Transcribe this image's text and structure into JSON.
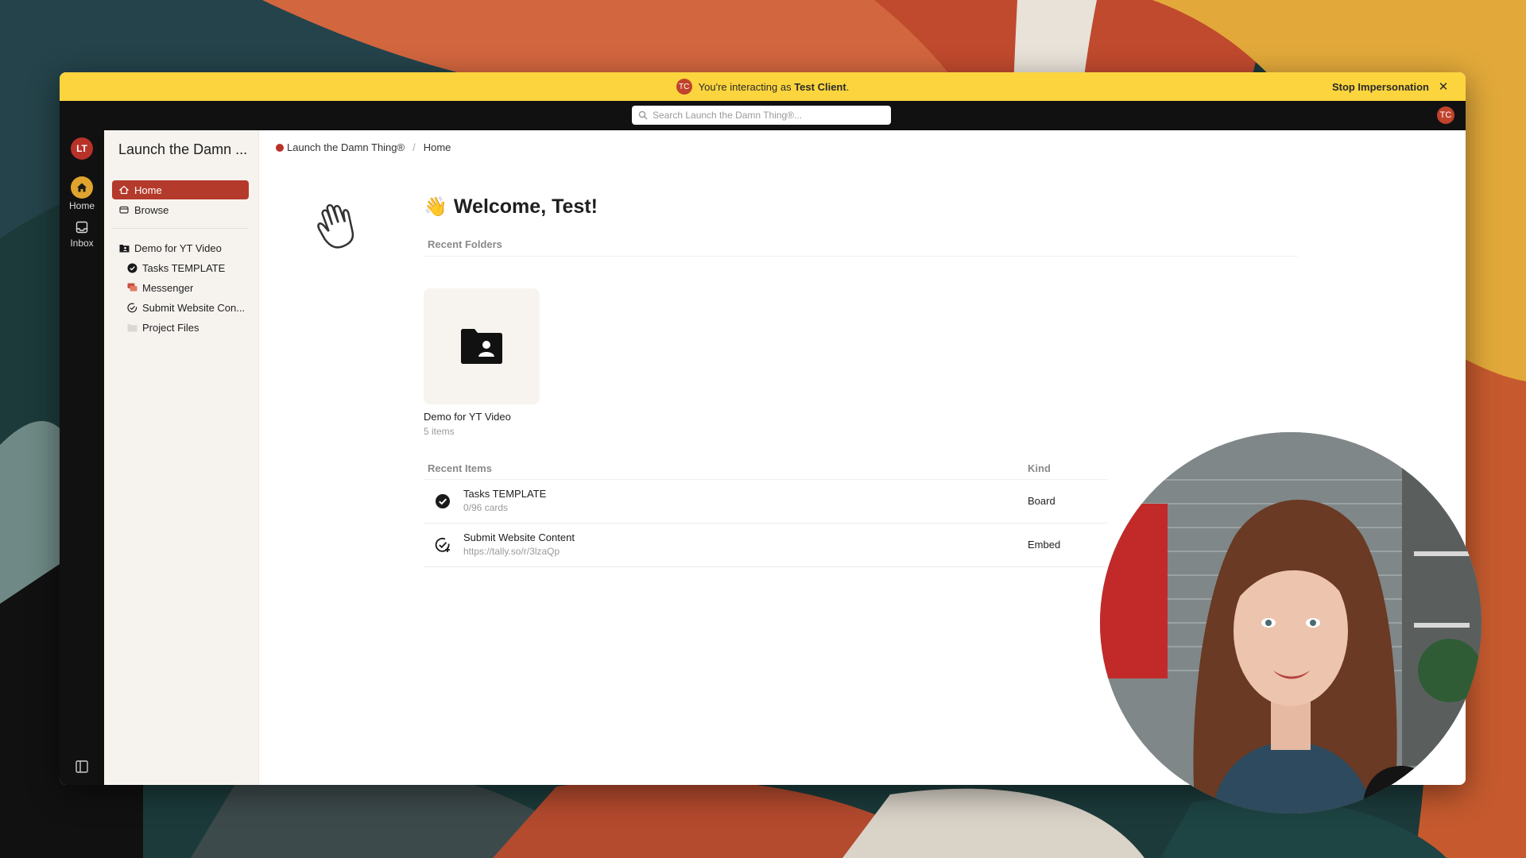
{
  "banner": {
    "avatar_initials": "TC",
    "prefix": "You're interacting as ",
    "user_name": "Test Client",
    "suffix": ".",
    "stop_label": "Stop Impersonation"
  },
  "topbar": {
    "search_placeholder": "Search Launch the Damn Thing®...",
    "avatar_initials": "TC"
  },
  "rail": {
    "logo": "LT",
    "items": [
      {
        "label": "Home",
        "icon": "home-icon"
      },
      {
        "label": "Inbox",
        "icon": "inbox-icon"
      }
    ]
  },
  "sidebar": {
    "workspace_title": "Launch the Damn ...",
    "nav": [
      {
        "label": "Home",
        "icon": "home-icon",
        "active": true
      },
      {
        "label": "Browse",
        "icon": "browse-icon",
        "active": false
      }
    ],
    "folder": {
      "label": "Demo for YT Video",
      "icon": "folder-icon"
    },
    "items": [
      {
        "label": "Tasks TEMPLATE",
        "icon": "check-circle-icon"
      },
      {
        "label": "Messenger",
        "icon": "chat-icon"
      },
      {
        "label": "Submit Website Con...",
        "icon": "check-add-icon"
      },
      {
        "label": "Project Files",
        "icon": "folder-icon"
      }
    ]
  },
  "breadcrumb": {
    "workspace": "Launch the Damn Thing®",
    "separator": "/",
    "current": "Home"
  },
  "welcome": {
    "emoji": "👋",
    "text": "Welcome, Test!"
  },
  "recent_folders": {
    "title": "Recent Folders",
    "items": [
      {
        "name": "Demo for YT Video",
        "count": "5 items"
      }
    ]
  },
  "recent_items": {
    "title": "Recent Items",
    "kind_header": "Kind",
    "rows": [
      {
        "name": "Tasks TEMPLATE",
        "sub": "0/96 cards",
        "kind": "Board",
        "icon": "check-circle-icon"
      },
      {
        "name": "Submit Website Content",
        "sub": "https://tally.so/r/3lzaQp",
        "kind": "Embed",
        "icon": "check-add-icon"
      }
    ]
  },
  "colors": {
    "banner": "#fcd53e",
    "accent": "#b43a2b",
    "home_rail": "#e0a32e"
  }
}
